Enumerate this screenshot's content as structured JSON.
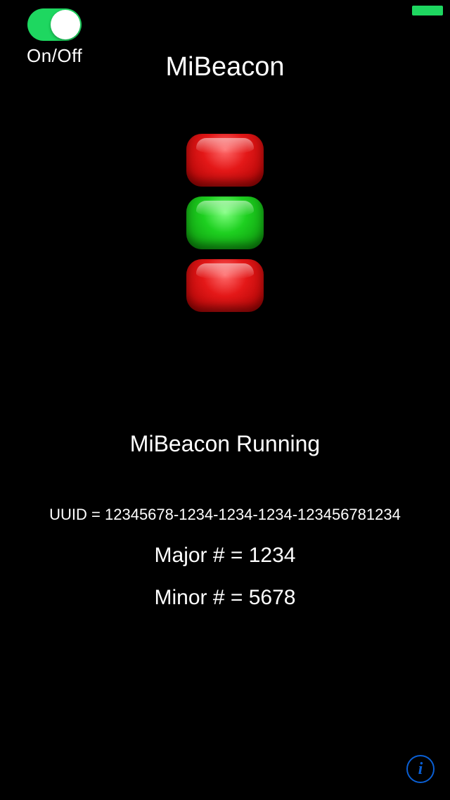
{
  "app": {
    "title": "MiBeacon"
  },
  "toggle": {
    "label": "On/Off",
    "state": "on"
  },
  "indicators": [
    {
      "color": "red"
    },
    {
      "color": "green"
    },
    {
      "color": "red"
    }
  ],
  "status": {
    "text": "MiBeacon Running"
  },
  "beacon": {
    "uuid_line": "UUID = 12345678-1234-1234-1234-123456781234",
    "major_line": "Major # = 1234",
    "minor_line": "Minor # = 5678"
  },
  "colors": {
    "accent_green": "#1ed760",
    "accent_blue": "#0a5fd4",
    "indicator_red": "#e41818",
    "indicator_green": "#1ed020"
  }
}
